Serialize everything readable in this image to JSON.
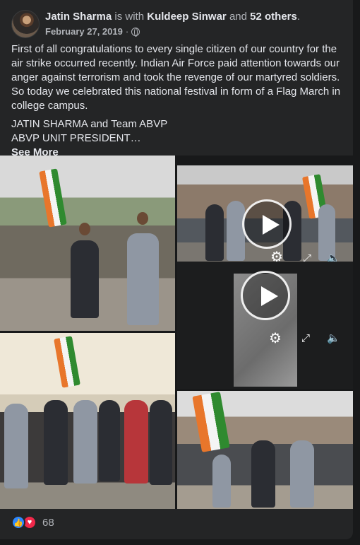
{
  "post": {
    "author": "Jatin Sharma",
    "with_text": "is with",
    "tagged": "Kuldeep Sinwar",
    "and_text": "and",
    "others": "52 others",
    "period": ".",
    "date": "February 27, 2019",
    "separator": "·",
    "privacy_icon": "globe-icon",
    "paragraph1_lines": [
      "First of all congratulations to every single citizen of our country for the",
      "air strike occurred recently. Indian Air Force paid attention towards our",
      "anger against terrorism and took the revenge of our martyred soldiers.",
      "So today we  celebrated this national festival in form of a Flag March in",
      "college campus."
    ],
    "paragraph2_line1": "JATIN SHARMA and Team ABVP",
    "paragraph2_line2": "ABVP UNIT PRESIDENT…",
    "see_more": "See More"
  },
  "media": {
    "play_icon": "play-icon",
    "settings_icon": "gear-icon",
    "expand_icon": "expand-icon",
    "mute_icon": "mute-icon"
  },
  "reactions": {
    "icons": [
      "like-icon",
      "love-icon"
    ],
    "count": "68"
  },
  "colors": {
    "background": "#18191a",
    "card": "#242526",
    "text_primary": "#e4e6eb",
    "text_secondary": "#b0b3b8",
    "like_blue": "#2d88ff",
    "love_red": "#f0284a"
  }
}
